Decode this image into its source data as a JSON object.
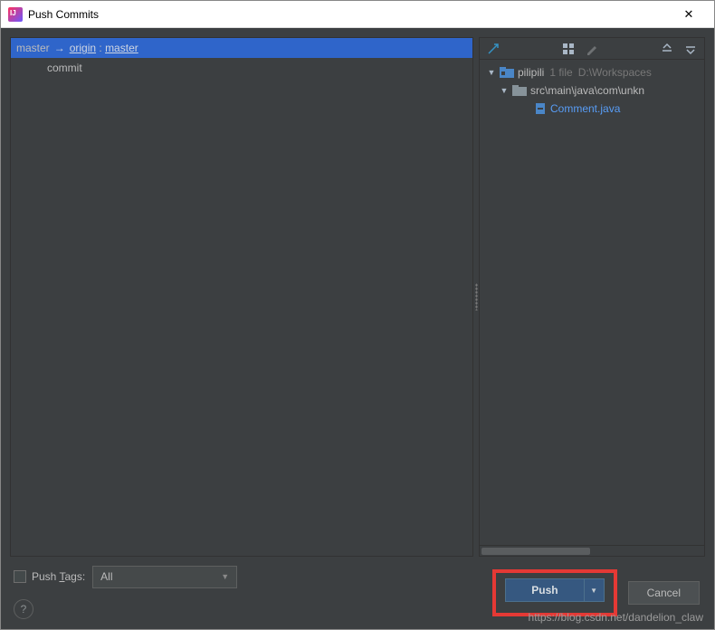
{
  "window": {
    "title": "Push Commits"
  },
  "branch": {
    "local": "master",
    "remote": "origin",
    "remote_branch": "master",
    "sep": ":"
  },
  "commits": [
    {
      "message": "commit"
    }
  ],
  "file_tree": {
    "root": {
      "name": "pilipili",
      "count_text": "1 file",
      "path": "D:\\Workspaces"
    },
    "folder": {
      "path": "src\\main\\java\\com\\unkn"
    },
    "file": {
      "name": "Comment.java"
    }
  },
  "footer": {
    "push_tags_label": "Push Tags:",
    "push_tags_underline_char": "T",
    "combo_value": "All",
    "push_button": "Push",
    "cancel_button": "Cancel"
  },
  "watermark": "https://blog.csdn.net/dandelion_claw"
}
